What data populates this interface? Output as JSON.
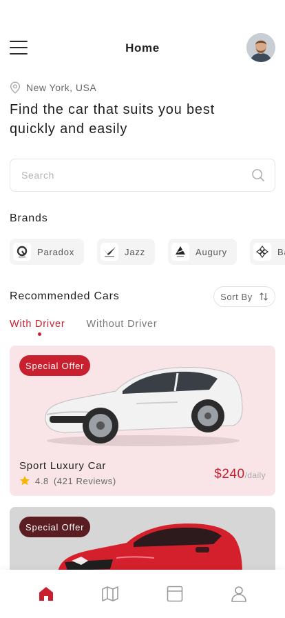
{
  "header": {
    "title": "Home",
    "menu_icon": "hamburger-menu-icon",
    "avatar_icon": "user-avatar"
  },
  "location": {
    "icon": "location-pin-icon",
    "text": "New York, USA"
  },
  "headline": "Find the car that suits you best quickly and easily",
  "search": {
    "placeholder": "Search",
    "value": "",
    "icon": "search-icon"
  },
  "brands": {
    "title": "Brands",
    "items": [
      {
        "label": "Paradox",
        "icon": "paradox-logo"
      },
      {
        "label": "Jazz",
        "icon": "jazz-logo"
      },
      {
        "label": "Augury",
        "icon": "augury-logo"
      },
      {
        "label": "Ba",
        "icon": "brand-logo"
      }
    ]
  },
  "recommended": {
    "title": "Recommended Cars",
    "sort_label": "Sort By",
    "sort_icon": "sort-arrows-icon",
    "tabs": [
      {
        "label": "With Driver",
        "active": true
      },
      {
        "label": "Without Driver",
        "active": false
      }
    ],
    "cars": [
      {
        "badge": "Special Offer",
        "name": "Sport Luxury Car",
        "rating": "4.8",
        "reviews": "(421 Reviews)",
        "price": "$240",
        "unit": "/daily",
        "color": "#f0f0f0"
      },
      {
        "badge": "Special Offer",
        "color": "#d4202c"
      }
    ]
  },
  "bottom_nav": [
    {
      "name": "home",
      "icon": "home-icon",
      "active": true
    },
    {
      "name": "map",
      "icon": "map-icon",
      "active": false
    },
    {
      "name": "bookings",
      "icon": "browser-window-icon",
      "active": false
    },
    {
      "name": "profile",
      "icon": "user-icon",
      "active": false
    }
  ],
  "colors": {
    "accent": "#c8202e",
    "card_pink": "#f9e5e8",
    "badge_dark": "#5a1d22"
  }
}
